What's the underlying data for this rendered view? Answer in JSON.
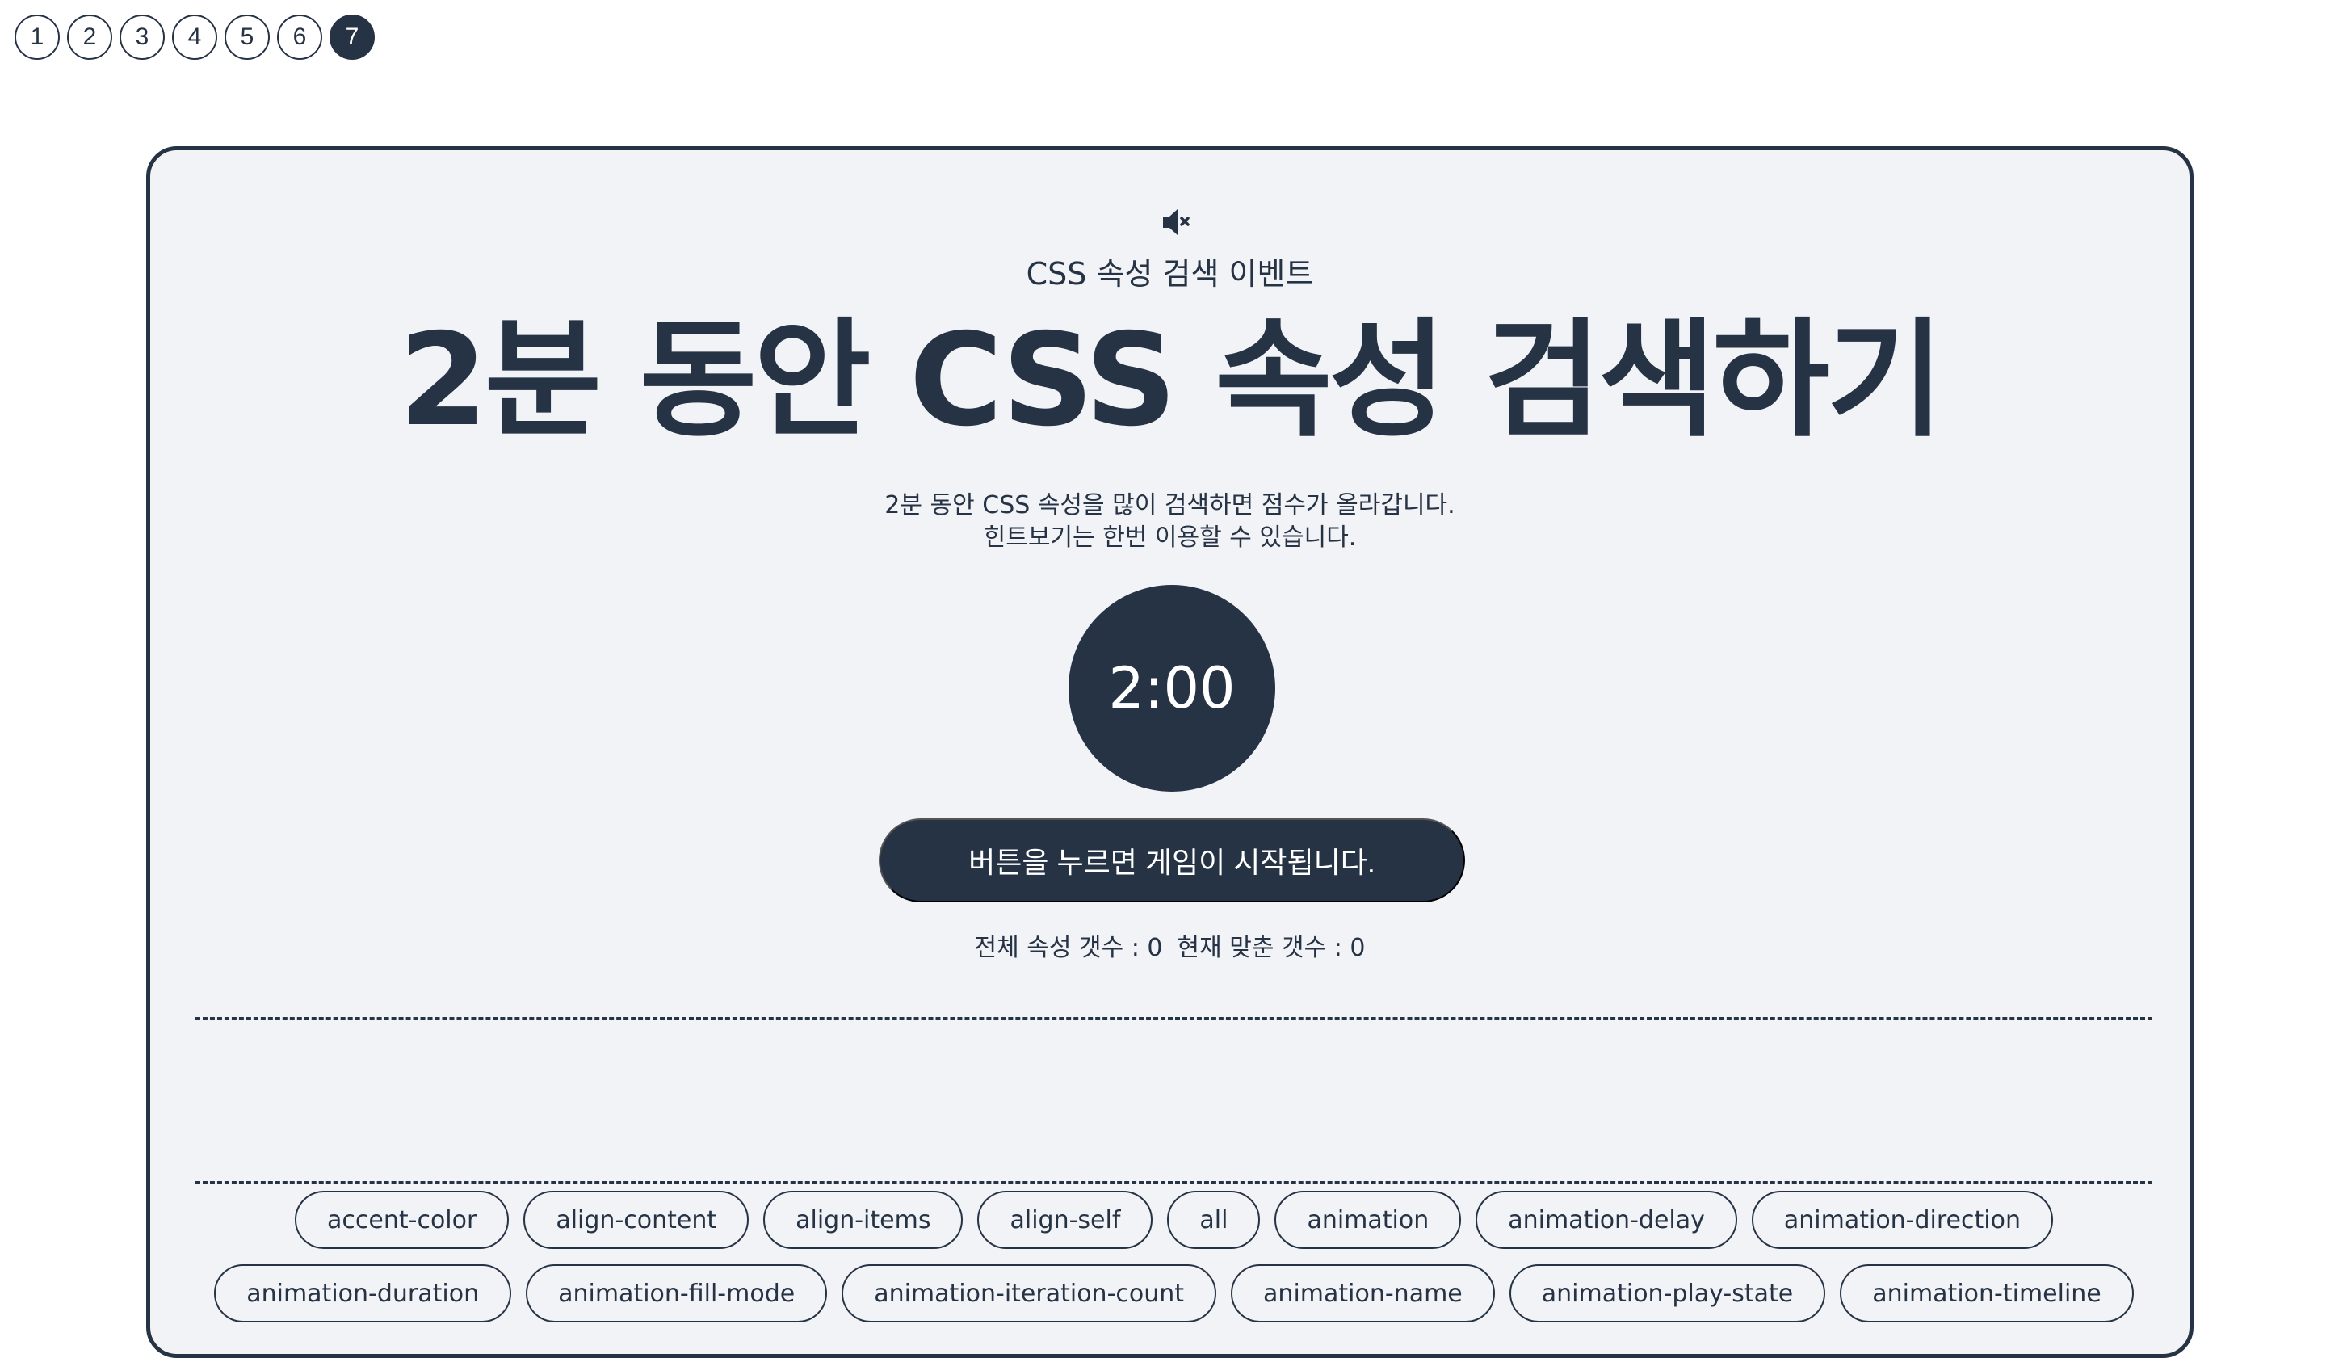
{
  "pagination": {
    "pages": [
      "1",
      "2",
      "3",
      "4",
      "5",
      "6",
      "7"
    ],
    "active": "7"
  },
  "header": {
    "mute_icon": "speaker-muted-icon",
    "subtitle": "CSS 속성 검색 이벤트",
    "title": "2분 동안 CSS 속성 검색하기",
    "desc_line1": "2분 동안 CSS 속성을 많이 검색하면 점수가 올라갑니다.",
    "desc_line2": "힌트보기는 한번 이용할 수 있습니다."
  },
  "timer": {
    "display": "2:00"
  },
  "start_button": {
    "label": "버튼을 누르면 게임이 시작됩니다."
  },
  "stats": {
    "total": "전체 속성 갯수 : 0",
    "current": "현재 맞춘 갯수 : 0"
  },
  "properties": [
    "accent-color",
    "align-content",
    "align-items",
    "align-self",
    "all",
    "animation",
    "animation-delay",
    "animation-direction",
    "animation-duration",
    "animation-fill-mode",
    "animation-iteration-count",
    "animation-name",
    "animation-play-state",
    "animation-timeline"
  ],
  "colors": {
    "primary": "#263345",
    "card_background": "#f1f3f6",
    "page_background": "#ffffff"
  }
}
